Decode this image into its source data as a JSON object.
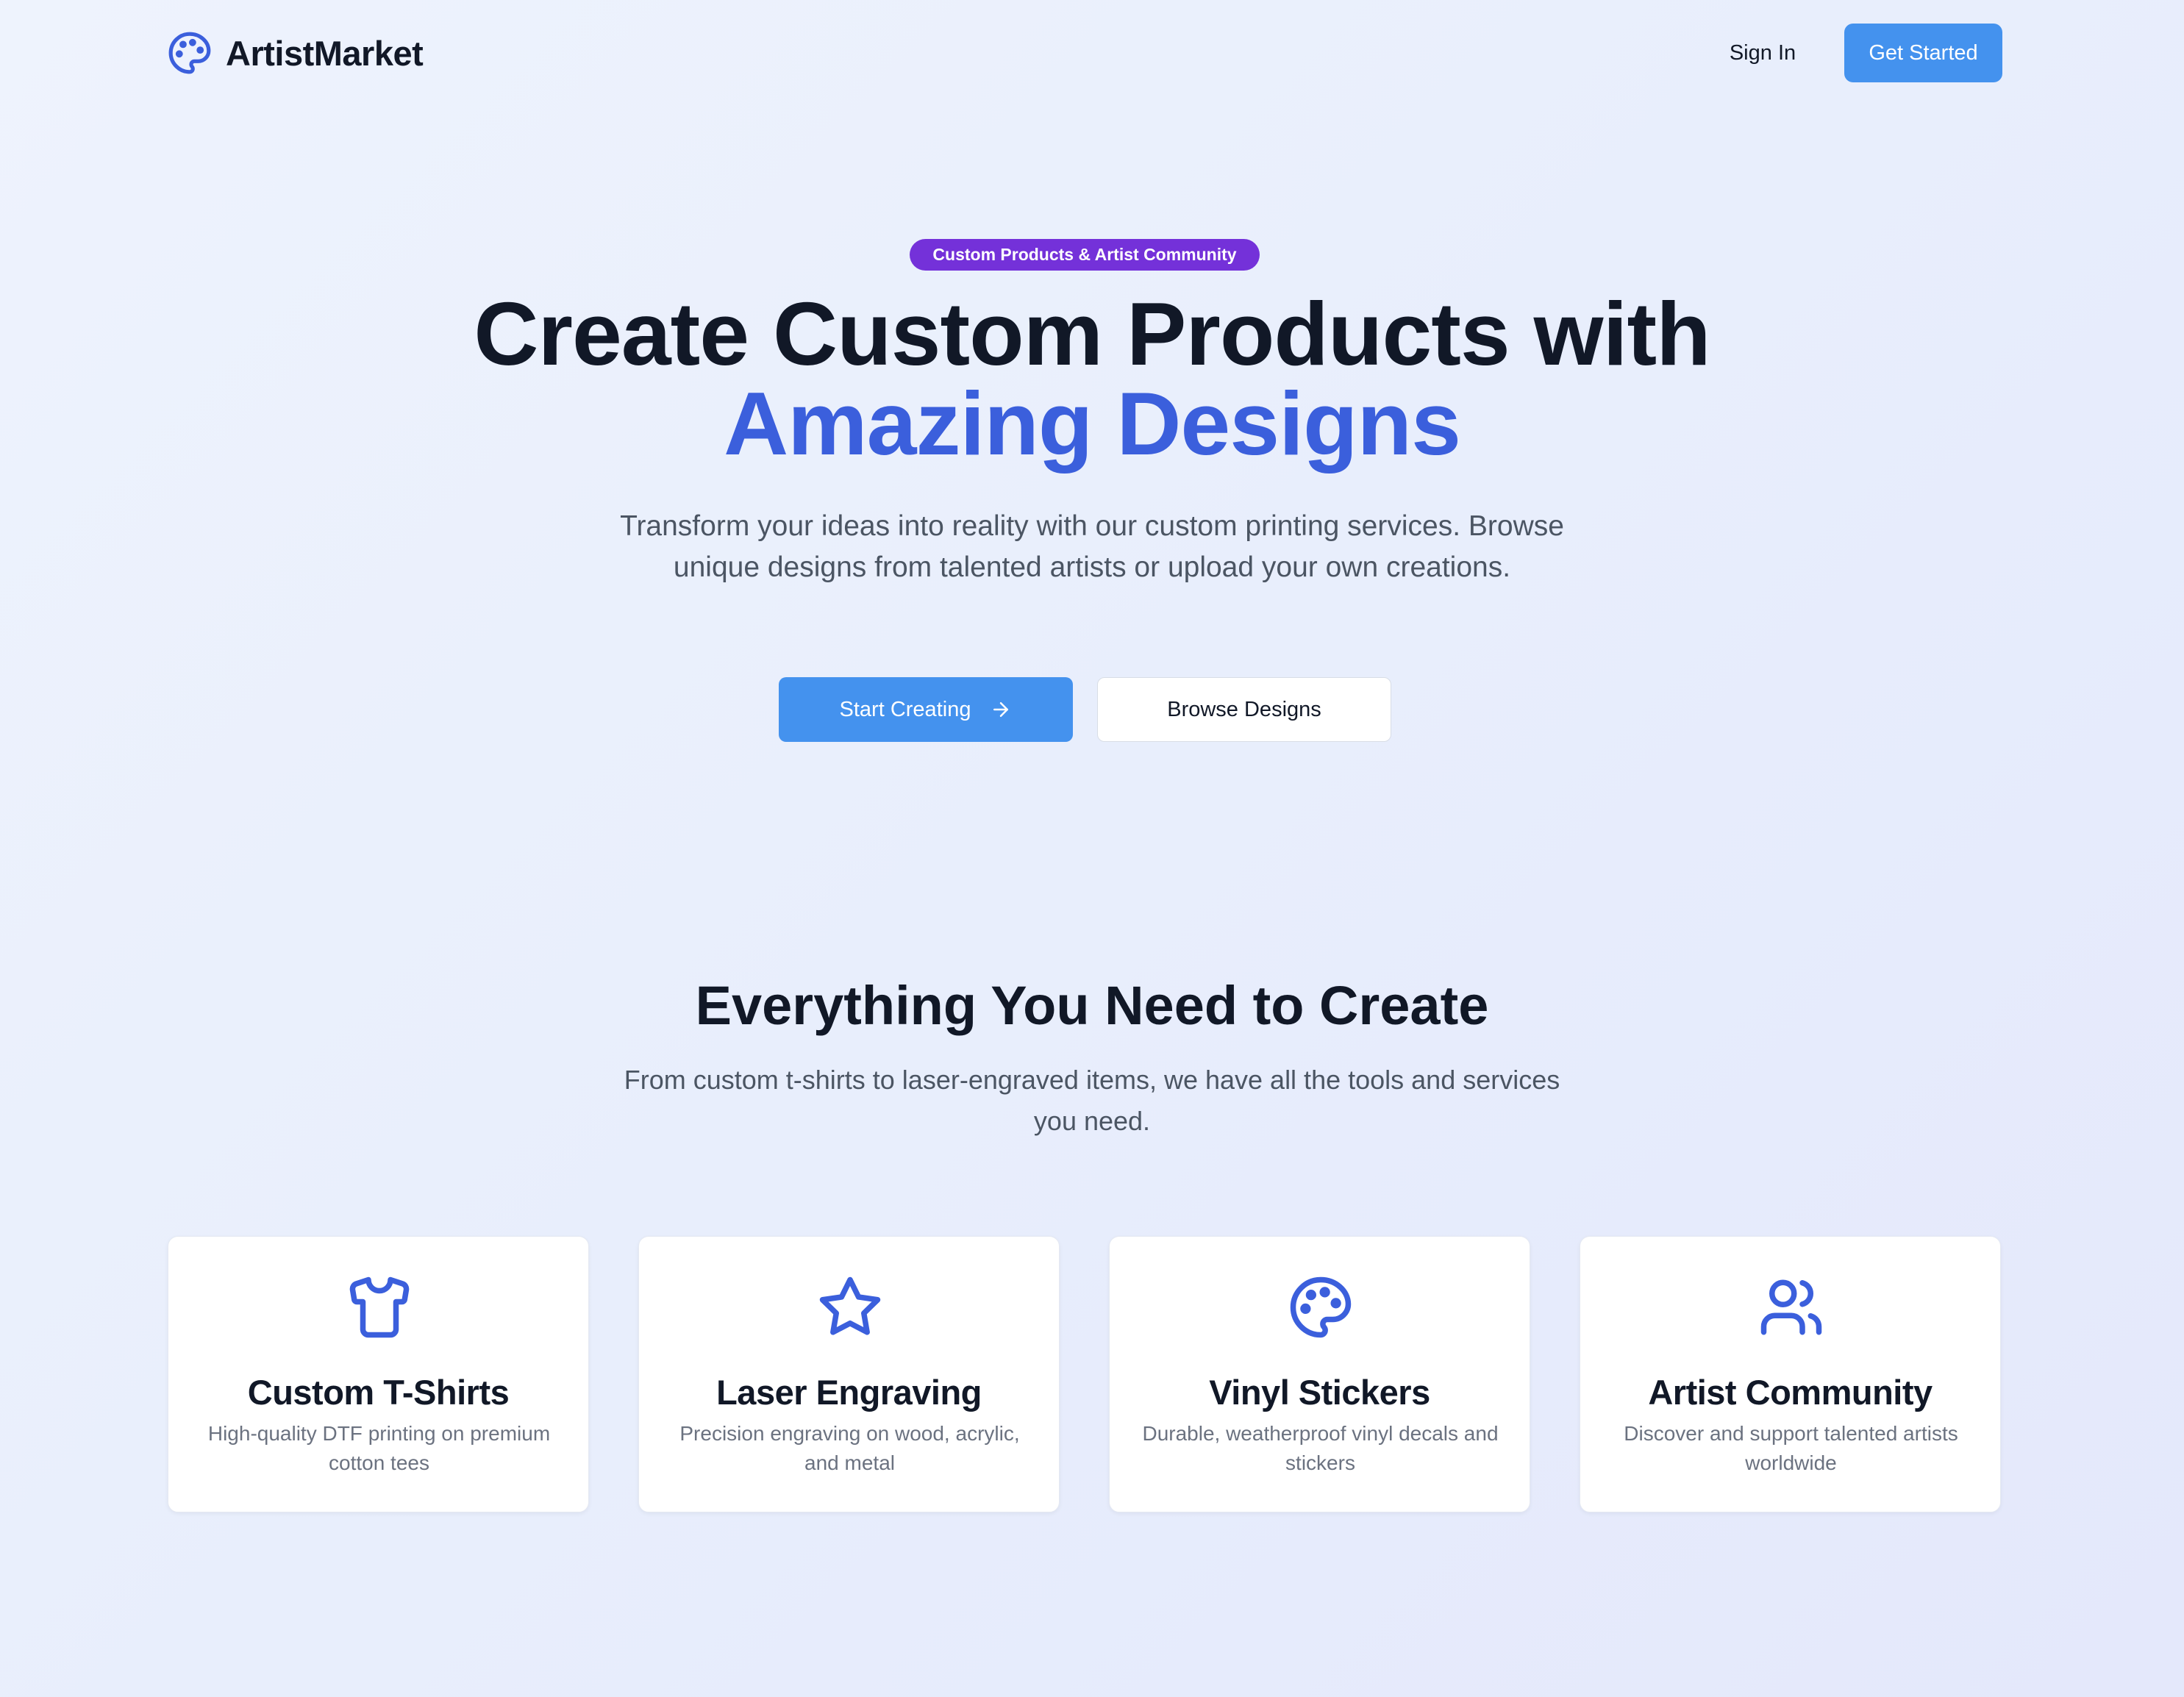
{
  "brand": {
    "name": "ArtistMarket",
    "icon": "palette-icon"
  },
  "nav": {
    "sign_in": "Sign In",
    "get_started": "Get Started"
  },
  "hero": {
    "badge": "Custom Products & Artist Community",
    "title_line1": "Create Custom Products with",
    "title_line2": "Amazing Designs",
    "subtitle": "Transform your ideas into reality with our custom printing services. Browse unique designs from talented artists or upload your own creations.",
    "primary_button": "Start Creating",
    "secondary_button": "Browse Designs"
  },
  "features": {
    "title": "Everything You Need to Create",
    "subtitle": "From custom t-shirts to laser-engraved items, we have all the tools and services you need.",
    "items": [
      {
        "icon": "t-shirt-icon",
        "title": "Custom T-Shirts",
        "description": "High-quality DTF printing on premium cotton tees"
      },
      {
        "icon": "star-icon",
        "title": "Laser Engraving",
        "description": "Precision engraving on wood, acrylic, and metal"
      },
      {
        "icon": "palette-icon",
        "title": "Vinyl Stickers",
        "description": "Durable, weatherproof vinyl decals and stickers"
      },
      {
        "icon": "users-icon",
        "title": "Artist Community",
        "description": "Discover and support talented artists worldwide"
      }
    ]
  },
  "colors": {
    "primary_button": "#4492ee",
    "accent_text": "#3b5fdc",
    "badge": "#7431d9",
    "icon": "#3b5fdc"
  }
}
